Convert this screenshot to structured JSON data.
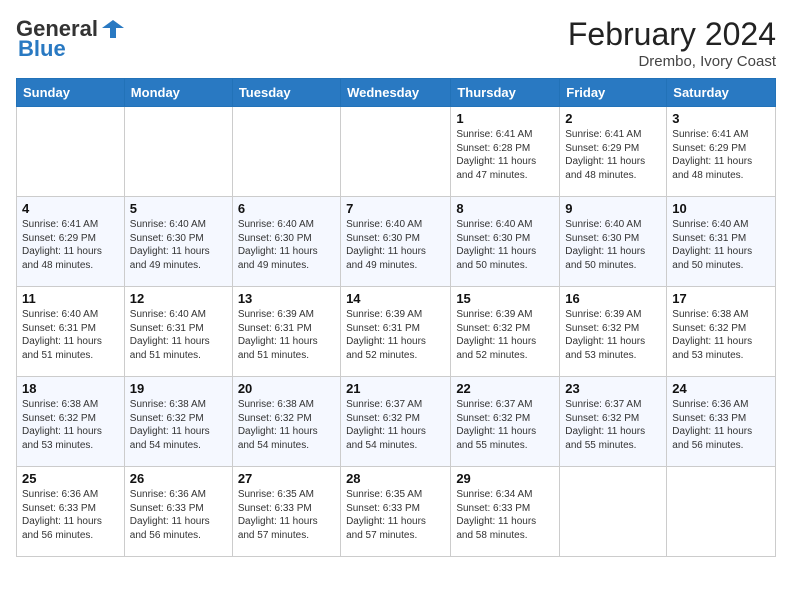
{
  "logo": {
    "general": "General",
    "blue": "Blue"
  },
  "title": "February 2024",
  "subtitle": "Drembo, Ivory Coast",
  "header_days": [
    "Sunday",
    "Monday",
    "Tuesday",
    "Wednesday",
    "Thursday",
    "Friday",
    "Saturday"
  ],
  "weeks": [
    [
      {
        "day": "",
        "info": ""
      },
      {
        "day": "",
        "info": ""
      },
      {
        "day": "",
        "info": ""
      },
      {
        "day": "",
        "info": ""
      },
      {
        "day": "1",
        "info": "Sunrise: 6:41 AM\nSunset: 6:28 PM\nDaylight: 11 hours and 47 minutes."
      },
      {
        "day": "2",
        "info": "Sunrise: 6:41 AM\nSunset: 6:29 PM\nDaylight: 11 hours and 48 minutes."
      },
      {
        "day": "3",
        "info": "Sunrise: 6:41 AM\nSunset: 6:29 PM\nDaylight: 11 hours and 48 minutes."
      }
    ],
    [
      {
        "day": "4",
        "info": "Sunrise: 6:41 AM\nSunset: 6:29 PM\nDaylight: 11 hours and 48 minutes."
      },
      {
        "day": "5",
        "info": "Sunrise: 6:40 AM\nSunset: 6:30 PM\nDaylight: 11 hours and 49 minutes."
      },
      {
        "day": "6",
        "info": "Sunrise: 6:40 AM\nSunset: 6:30 PM\nDaylight: 11 hours and 49 minutes."
      },
      {
        "day": "7",
        "info": "Sunrise: 6:40 AM\nSunset: 6:30 PM\nDaylight: 11 hours and 49 minutes."
      },
      {
        "day": "8",
        "info": "Sunrise: 6:40 AM\nSunset: 6:30 PM\nDaylight: 11 hours and 50 minutes."
      },
      {
        "day": "9",
        "info": "Sunrise: 6:40 AM\nSunset: 6:30 PM\nDaylight: 11 hours and 50 minutes."
      },
      {
        "day": "10",
        "info": "Sunrise: 6:40 AM\nSunset: 6:31 PM\nDaylight: 11 hours and 50 minutes."
      }
    ],
    [
      {
        "day": "11",
        "info": "Sunrise: 6:40 AM\nSunset: 6:31 PM\nDaylight: 11 hours and 51 minutes."
      },
      {
        "day": "12",
        "info": "Sunrise: 6:40 AM\nSunset: 6:31 PM\nDaylight: 11 hours and 51 minutes."
      },
      {
        "day": "13",
        "info": "Sunrise: 6:39 AM\nSunset: 6:31 PM\nDaylight: 11 hours and 51 minutes."
      },
      {
        "day": "14",
        "info": "Sunrise: 6:39 AM\nSunset: 6:31 PM\nDaylight: 11 hours and 52 minutes."
      },
      {
        "day": "15",
        "info": "Sunrise: 6:39 AM\nSunset: 6:32 PM\nDaylight: 11 hours and 52 minutes."
      },
      {
        "day": "16",
        "info": "Sunrise: 6:39 AM\nSunset: 6:32 PM\nDaylight: 11 hours and 53 minutes."
      },
      {
        "day": "17",
        "info": "Sunrise: 6:38 AM\nSunset: 6:32 PM\nDaylight: 11 hours and 53 minutes."
      }
    ],
    [
      {
        "day": "18",
        "info": "Sunrise: 6:38 AM\nSunset: 6:32 PM\nDaylight: 11 hours and 53 minutes."
      },
      {
        "day": "19",
        "info": "Sunrise: 6:38 AM\nSunset: 6:32 PM\nDaylight: 11 hours and 54 minutes."
      },
      {
        "day": "20",
        "info": "Sunrise: 6:38 AM\nSunset: 6:32 PM\nDaylight: 11 hours and 54 minutes."
      },
      {
        "day": "21",
        "info": "Sunrise: 6:37 AM\nSunset: 6:32 PM\nDaylight: 11 hours and 54 minutes."
      },
      {
        "day": "22",
        "info": "Sunrise: 6:37 AM\nSunset: 6:32 PM\nDaylight: 11 hours and 55 minutes."
      },
      {
        "day": "23",
        "info": "Sunrise: 6:37 AM\nSunset: 6:32 PM\nDaylight: 11 hours and 55 minutes."
      },
      {
        "day": "24",
        "info": "Sunrise: 6:36 AM\nSunset: 6:33 PM\nDaylight: 11 hours and 56 minutes."
      }
    ],
    [
      {
        "day": "25",
        "info": "Sunrise: 6:36 AM\nSunset: 6:33 PM\nDaylight: 11 hours and 56 minutes."
      },
      {
        "day": "26",
        "info": "Sunrise: 6:36 AM\nSunset: 6:33 PM\nDaylight: 11 hours and 56 minutes."
      },
      {
        "day": "27",
        "info": "Sunrise: 6:35 AM\nSunset: 6:33 PM\nDaylight: 11 hours and 57 minutes."
      },
      {
        "day": "28",
        "info": "Sunrise: 6:35 AM\nSunset: 6:33 PM\nDaylight: 11 hours and 57 minutes."
      },
      {
        "day": "29",
        "info": "Sunrise: 6:34 AM\nSunset: 6:33 PM\nDaylight: 11 hours and 58 minutes."
      },
      {
        "day": "",
        "info": ""
      },
      {
        "day": "",
        "info": ""
      }
    ]
  ]
}
